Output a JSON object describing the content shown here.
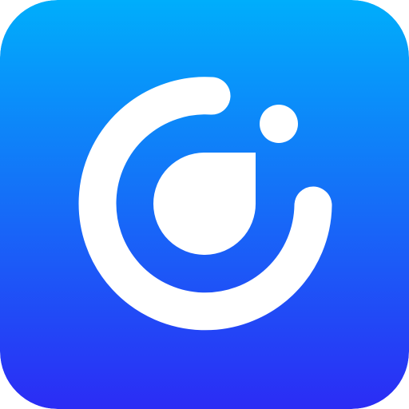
{
  "icon": {
    "name": "app-logo-icon",
    "glyph_color": "#ffffff",
    "gradient_top": "#00aefb",
    "gradient_bottom": "#2b2cf5"
  }
}
